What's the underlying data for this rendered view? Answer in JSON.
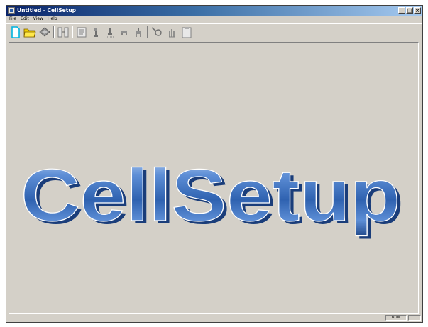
{
  "window": {
    "title": "Untitled - CellSetup",
    "buttons": {
      "minimize": "_",
      "maximize": "□",
      "close": "×"
    }
  },
  "menu": [
    {
      "underline": "F",
      "rest": "ile"
    },
    {
      "underline": "E",
      "rest": "dit"
    },
    {
      "underline": "V",
      "rest": "iew"
    },
    {
      "underline": "H",
      "rest": "elp"
    }
  ],
  "toolbar": {
    "icons": [
      "new-document-icon",
      "open-folder-icon",
      "save-icon",
      "compare-icon",
      "list-icon",
      "robot-arm-icon",
      "robot-jog-icon",
      "gripper-icon",
      "tool-icon",
      "zoom-icon",
      "hand-icon",
      "clipboard-icon"
    ]
  },
  "splash": {
    "text": "CellSetup",
    "color": "#2f62b0"
  },
  "statusbar": {
    "num": "NUM"
  }
}
